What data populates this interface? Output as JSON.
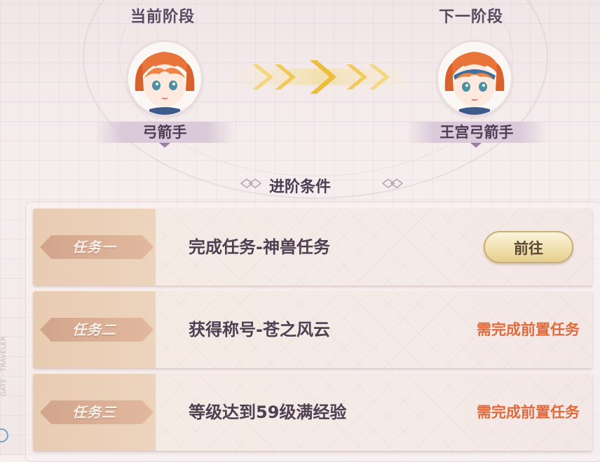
{
  "current_stage": {
    "title": "当前阶段",
    "name": "弓箭手"
  },
  "next_stage": {
    "title": "下一阶段",
    "name": "王宫弓箭手"
  },
  "section_title": "进阶条件",
  "side_watermark": "GATE · TRAVELER",
  "tasks": [
    {
      "label": "任务一",
      "desc": "完成任务-神兽任务",
      "action": "前往"
    },
    {
      "label": "任务二",
      "desc": "获得称号-苍之风云",
      "status": "需完成前置任务"
    },
    {
      "label": "任务三",
      "desc": "等级达到59级满经验",
      "status": "需完成前置任务"
    }
  ],
  "colors": {
    "accent_gold": "#f1e1b0",
    "status_orange": "#e06a3c",
    "title_purple": "#5a4760"
  },
  "icons": {
    "arrows": "chevron-right-arrows-icon",
    "diamond": "diamond-ornament-icon"
  }
}
